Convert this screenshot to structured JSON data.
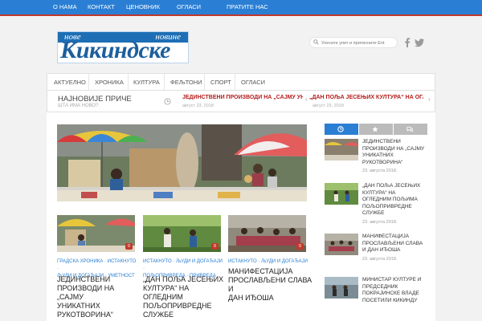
{
  "topbar": {
    "items": [
      "О НАМА",
      "КОНТАКТ",
      "ЦЕНОВНИК",
      "ОГЛАСИ",
      "ПРАТИТЕ НАС"
    ]
  },
  "logo": {
    "word1": "нове",
    "word2": "новине",
    "main": "Кикиндске"
  },
  "search": {
    "placeholder": "Унесите упит и притисните Ent"
  },
  "social": {
    "icons": [
      "facebook-icon",
      "twitter-icon"
    ]
  },
  "nav": {
    "items": [
      "АКТУЕЛНО",
      "ХРОНИКА",
      "КУЛТУРА",
      "ФЕЉТОНИ",
      "СПОРТ",
      "ОГЛАСИ"
    ]
  },
  "ticker": {
    "title": "НАЈНОВИЈЕ ПРИЧЕ",
    "subtitle": "ШТА ИМА НОВО?",
    "items": [
      {
        "headline": "ЈЕДИНСТВЕНИ ПРОИЗВОДИ НА „САЈМУ УНИ",
        "date": "август 23, 2018"
      },
      {
        "headline": "„ДАН ПОЉА ЈЕСЕЊИХ КУЛТУРА“ НА ОГЛ",
        "date": "август 23, 2018"
      }
    ],
    "prev": "‹",
    "next": "›"
  },
  "cards": [
    {
      "comments": "0",
      "categories": [
        "ГРАДСКА ХРОНИКА",
        "ИСТАКНУТО",
        "ЉУДИ И ДОГАЂАЈИ",
        "УМЕТНОСТ"
      ],
      "title": [
        "ЈЕДИНСТВЕНИ",
        "ПРОИЗВОДИ НА „САЈМУ",
        "УНИКАТНИХ",
        "РУКОТВОРИНА“"
      ]
    },
    {
      "comments": "0",
      "categories": [
        "ИСТАКНУТО",
        "ЉУДИ И ДОГАЂАЈИ",
        "ПОЉОПРИВРЕДА",
        "ПРИВРЕДА"
      ],
      "title": [
        "„ДАН ПОЉА ЈЕСЕЊИХ",
        "КУЛТУРА“ НА ОГЛЕДНИМ",
        "ПОЉОПРИВРЕДНЕ",
        "СЛУЖБЕ"
      ]
    },
    {
      "comments": "0",
      "categories": [
        "ИСТАКНУТО",
        "ЉУДИ И ДОГАЂАЈИ"
      ],
      "title": [
        "МАНИФЕСТАЦИЈА",
        "ПРОСЛАВЉЕНИ СЛАВА И",
        "ДАН ИЂОША"
      ]
    }
  ],
  "sidebar": {
    "tabs": [
      "clock-icon",
      "star-icon",
      "comments-icon"
    ],
    "items": [
      {
        "title": [
          "ЈЕДИНСТВЕНИ",
          "ПРОИЗВОДИ НА „САЈМУ",
          "УНИКАТНИХ",
          "РУКОТВОРИНА“"
        ],
        "date": "23. августа 2018."
      },
      {
        "title": [
          "„ДАН ПОЉА ЈЕСЕЊИХ",
          "КУЛТУРА“ НА",
          "ОГЛЕДНИМ ПОЉИМА",
          "ПОЉОПРИВРЕДНЕ",
          "СЛУЖБЕ"
        ],
        "date": "23. августа 2018."
      },
      {
        "title": [
          "МАНИФЕСТАЦИЈА",
          "ПРОСЛАВЉЕНИ СЛАВА",
          "И ДАН ИЂОША"
        ],
        "date": "23. августа 2018."
      },
      {
        "title": [
          "МИНИСТАР КУЛТУРЕ И",
          "ПРЕДСЕДНИК",
          "ПОКРАЈИНСКЕ ВЛАДЕ",
          "ПОСЕТИЛИ КИКИНДУ"
        ],
        "date": ""
      }
    ]
  },
  "colors": {
    "accent": "#2a7fd4",
    "headline_red": "#b51c1c",
    "comment_badge": "#c0392b"
  }
}
